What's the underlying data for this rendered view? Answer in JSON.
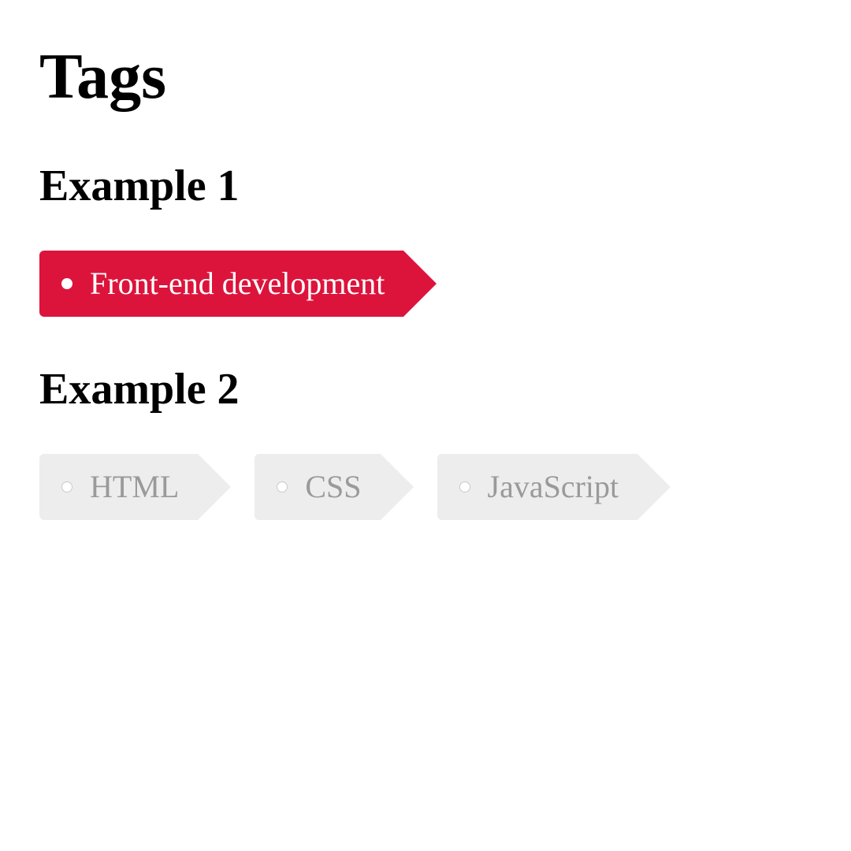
{
  "page": {
    "title": "Tags"
  },
  "example1": {
    "heading": "Example 1",
    "tags": [
      {
        "label": "Front-end development"
      }
    ]
  },
  "example2": {
    "heading": "Example 2",
    "tags": [
      {
        "label": "HTML"
      },
      {
        "label": "CSS"
      },
      {
        "label": "JavaScript"
      }
    ]
  },
  "colors": {
    "accent": "#dc143c",
    "muted_bg": "#ededed",
    "muted_text": "#9a9a9a"
  }
}
